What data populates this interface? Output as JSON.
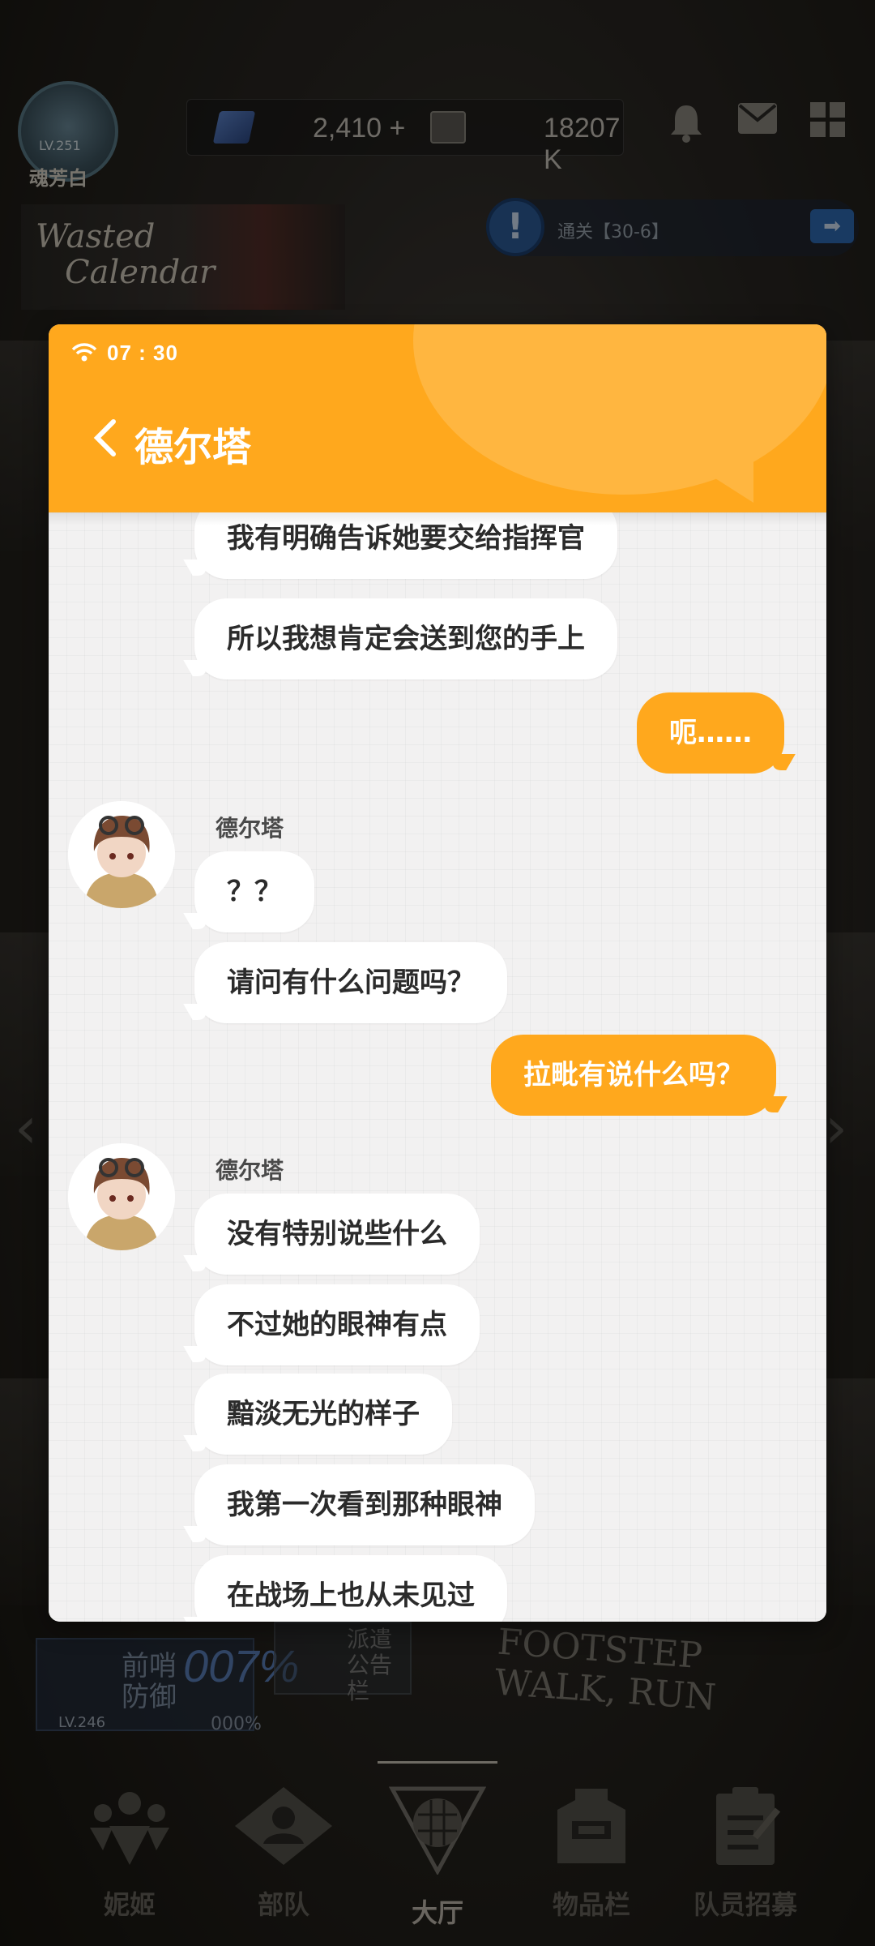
{
  "hub": {
    "player": {
      "level": "LV.251",
      "name": "魂芳白"
    },
    "currency": {
      "gems": "2,410",
      "gems_add": "+",
      "credits": "18207 K"
    },
    "banner": {
      "line1": "Wasted",
      "line2": "Calendar"
    },
    "mission": {
      "text": "通关【30-6】"
    },
    "widgets": {
      "defense_label": "前哨防御",
      "defense_pct": "007%",
      "defense_level": "LV.246",
      "defense_pct_small": "000%",
      "board_label": "派遣公告栏",
      "footstep_line1": "FOOTSTEP",
      "footstep_line2": "WALK, RUN"
    },
    "nav": [
      {
        "label": "妮姬",
        "icon": "nikke-icon"
      },
      {
        "label": "部队",
        "icon": "squad-icon"
      },
      {
        "label": "大厅",
        "icon": "lobby-icon"
      },
      {
        "label": "物品栏",
        "icon": "inventory-icon"
      },
      {
        "label": "队员招募",
        "icon": "recruit-icon"
      }
    ],
    "icons": {
      "bell": "bell-icon",
      "mail": "mail-icon",
      "grid": "grid-menu-icon"
    }
  },
  "chat": {
    "status": {
      "time": "07 : 30",
      "icon": "wifi-icon"
    },
    "title": "德尔塔",
    "back_icon": "back-chevron-icon",
    "accent_color": "#ffa81d",
    "messages": [
      {
        "from": "them",
        "text": "我有明确告诉她要交给指挥官"
      },
      {
        "from": "them",
        "text": "所以我想肯定会送到您的手上"
      },
      {
        "from": "me",
        "text": "呃……"
      },
      {
        "from": "them",
        "sender": "德尔塔",
        "text": "？？"
      },
      {
        "from": "them",
        "text": "请问有什么问题吗？"
      },
      {
        "from": "me",
        "text": "拉毗有说什么吗？"
      },
      {
        "from": "them",
        "sender": "德尔塔",
        "text": "没有特别说些什么"
      },
      {
        "from": "them",
        "text": "不过她的眼神有点"
      },
      {
        "from": "them",
        "text": "黯淡无光的样子"
      },
      {
        "from": "them",
        "text": "我第一次看到那种眼神"
      },
      {
        "from": "them",
        "text": "在战场上也从未见过"
      }
    ]
  }
}
